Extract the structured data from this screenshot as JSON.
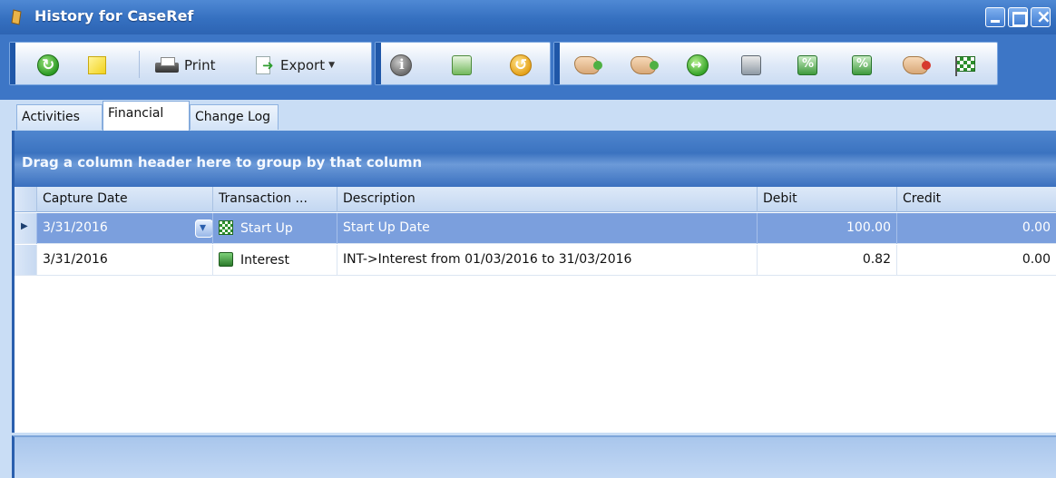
{
  "window": {
    "title": "History for CaseRef",
    "colors": {
      "title_bar": "#3570c0",
      "toolbar": "#3d76c6",
      "selected_row": "#7b9fdd"
    }
  },
  "toolbar": {
    "print_label": "Print",
    "export_label": "Export",
    "icons": [
      "refresh-icon",
      "note-icon",
      "printer-icon",
      "export-icon",
      "info-icon",
      "document-icon",
      "undo-icon",
      "payment-hand-icon",
      "payment-hand-add-icon",
      "transfer-icon",
      "calendar-icon",
      "percent-money-icon",
      "percent-icon",
      "cancel-payment-icon",
      "finish-flag-icon"
    ]
  },
  "tabs": [
    {
      "label": "Activities"
    },
    {
      "label": "Financial"
    },
    {
      "label": "Change Log"
    }
  ],
  "grid": {
    "group_hint": "Drag a column header here to group by that column",
    "columns": [
      "Capture Date",
      "Transaction ...",
      "Description",
      "Debit",
      "Credit"
    ],
    "rows": [
      {
        "capture_date": "3/31/2016",
        "transaction": "Start Up",
        "description": "Start Up Date",
        "debit": "100.00",
        "credit": "0.00"
      },
      {
        "capture_date": "3/31/2016",
        "transaction": "Interest",
        "description": "INT->Interest from 01/03/2016 to 31/03/2016",
        "debit": "0.82",
        "credit": "0.00"
      }
    ]
  }
}
